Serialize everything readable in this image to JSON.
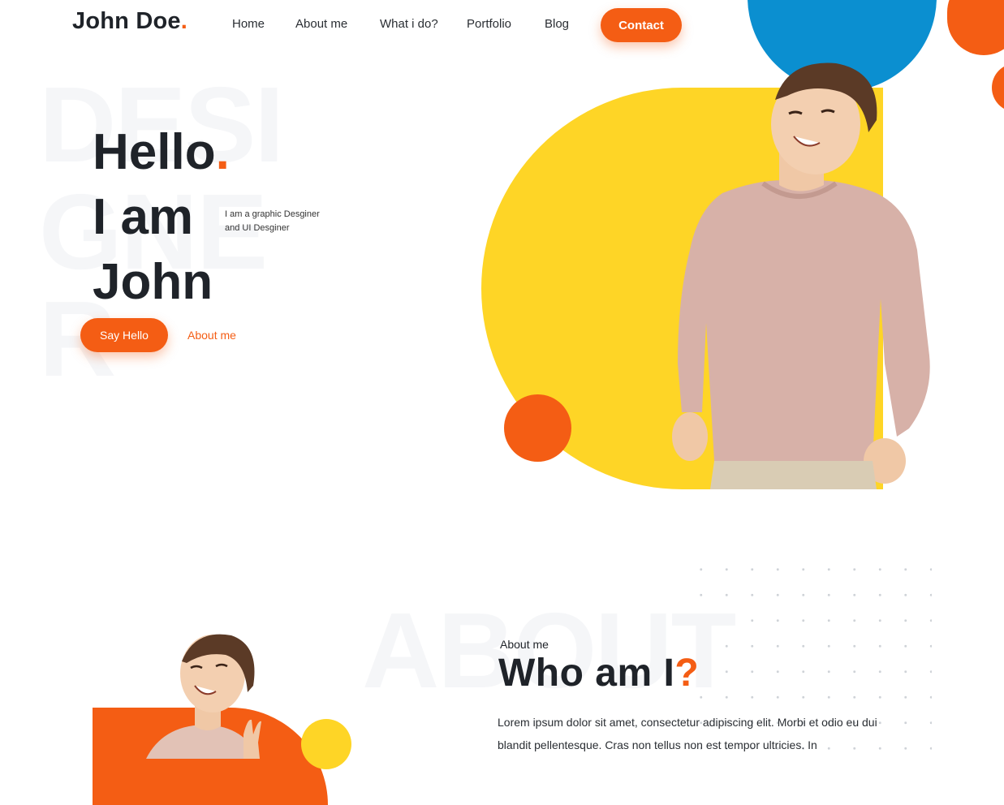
{
  "brand": {
    "name": "John Doe",
    "dot": "."
  },
  "nav": {
    "items": [
      "Home",
      "About me",
      "What i do?",
      "Portfolio",
      "Blog"
    ],
    "contact_label": "Contact"
  },
  "hero": {
    "watermark": "DESIGNER",
    "line1": "Hello",
    "line1_dot": ".",
    "line2": "I am",
    "line3": "John",
    "subtitle_line1": "I am a graphic Desginer",
    "subtitle_line2": "and UI Desginer",
    "say_hello_label": "Say Hello",
    "about_link_label": "About me"
  },
  "about": {
    "watermark": "ABOUT",
    "kicker": "About me",
    "title": "Who am I",
    "title_mark": "?",
    "body": "Lorem ipsum dolor sit amet, consectetur adipiscing elit. Morbi et odio eu dui blandit pellentesque. Cras non tellus non est tempor ultricies. In"
  },
  "colors": {
    "accent": "#f45d14",
    "yellow": "#fed526",
    "blue": "#0b8fd0",
    "text": "#1f2329"
  }
}
